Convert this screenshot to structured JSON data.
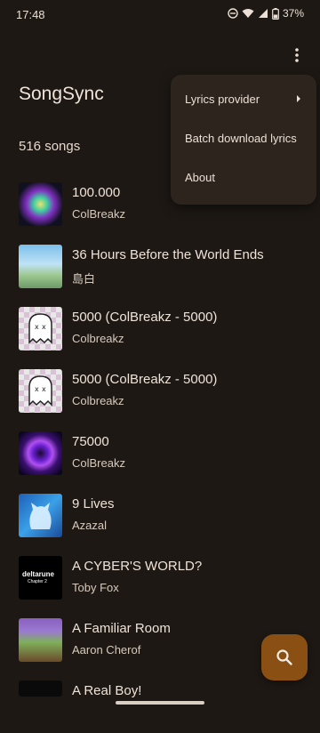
{
  "status": {
    "time": "17:48",
    "battery": "37%"
  },
  "app": {
    "title": "SongSync",
    "song_count": "516 songs"
  },
  "menu": {
    "items": [
      {
        "label": "Lyrics provider"
      },
      {
        "label": "Batch download lyrics"
      },
      {
        "label": "About"
      }
    ]
  },
  "songs": [
    {
      "title": "100.000",
      "artist": "ColBreakz"
    },
    {
      "title": "36 Hours Before the World Ends",
      "artist": "島白"
    },
    {
      "title": "5000 (ColBreakz - 5000)",
      "artist": "Colbreakz"
    },
    {
      "title": "5000 (ColBreakz - 5000)",
      "artist": "Colbreakz"
    },
    {
      "title": "75000",
      "artist": "ColBreakz"
    },
    {
      "title": "9 Lives",
      "artist": "Azazal"
    },
    {
      "title": "A CYBER'S WORLD?",
      "artist": "Toby Fox",
      "art_text": "deltarune",
      "art_subtext": "Chapter 2"
    },
    {
      "title": "A Familiar Room",
      "artist": "Aaron Cherof"
    },
    {
      "title": "A Real Boy!",
      "artist": ""
    }
  ],
  "colors": {
    "background": "#1d1814",
    "menu": "#2c241d",
    "fab": "#8a4f12"
  },
  "icons": {
    "overflow": "more-vert-icon",
    "fab": "search-icon",
    "submenu": "chevron-right-icon"
  }
}
